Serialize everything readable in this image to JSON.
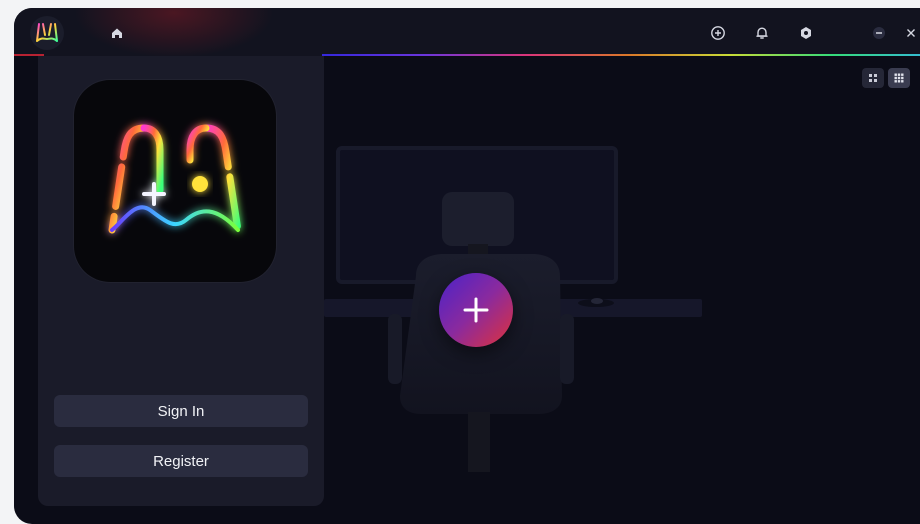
{
  "titlebar": {
    "icons": {
      "app_logo": "gamepad-neon-logo",
      "home": "home-icon",
      "add": "plus-circle-icon",
      "notifications": "bell-icon",
      "settings": "gear-icon",
      "minimize": "minimize-icon",
      "close": "close-icon"
    }
  },
  "sidebar": {
    "logo": "gamepad-neon-logo",
    "sign_in_label": "Sign In",
    "register_label": "Register"
  },
  "main": {
    "view_toggles": [
      "grid-small-icon",
      "grid-large-icon"
    ],
    "add_icon": "plus-icon"
  },
  "colors": {
    "window_bg": "#0b0c17",
    "titlebar_bg": "#12131f",
    "sidebar_bg": "#1a1b29",
    "button_bg": "#2a2c3f",
    "accent_gradient": [
      "#4a22c9",
      "#e0323a"
    ]
  }
}
